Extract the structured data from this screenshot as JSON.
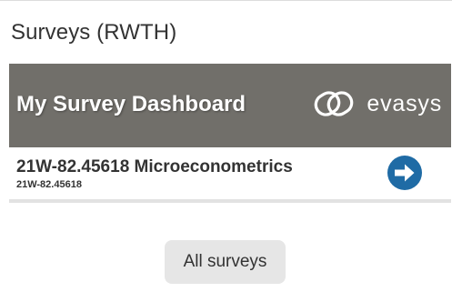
{
  "block": {
    "title": "Surveys (RWTH)"
  },
  "dashboard": {
    "title": "My Survey Dashboard",
    "brand": {
      "name": "evasys",
      "icon": "evasys-logo-icon"
    },
    "surveys": [
      {
        "name": "21W-82.45618 Microeconometrics",
        "code": "21W-82.45618",
        "action_icon": "arrow-right-circle-icon"
      }
    ]
  },
  "footer": {
    "all_surveys_label": "All surveys"
  },
  "colors": {
    "header_bg": "#716f6a",
    "arrow_icon": "#1f6ba5",
    "button_bg": "#e6e6e6",
    "text": "#333333"
  }
}
